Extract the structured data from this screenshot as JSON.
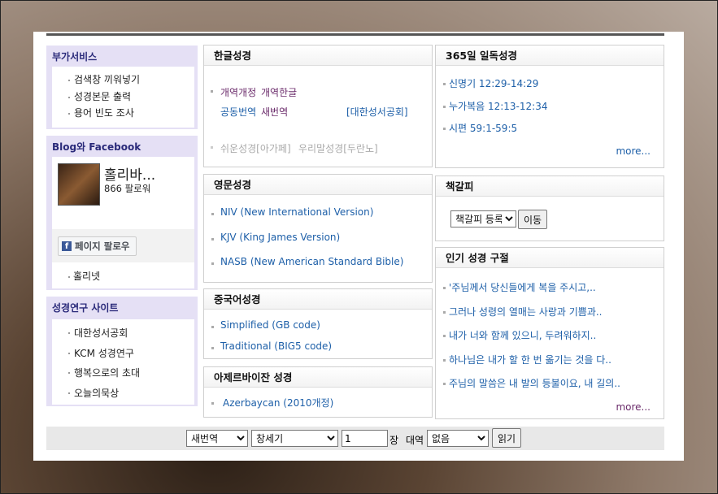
{
  "sidebar": {
    "addon": {
      "title": "부가서비스",
      "items": [
        "검색창 끼워넣기",
        "성경본문 출력",
        "용어 빈도 조사"
      ]
    },
    "social": {
      "title": "Blog와 Facebook",
      "page_name": "홀리바...",
      "followers": "866 팔로워",
      "follow_label": "페이지 팔로우",
      "link": "홀리넷"
    },
    "research": {
      "title": "성경연구 사이트",
      "items": [
        "대한성서공회",
        "KCM 성경연구",
        "행복으로의 초대",
        "오늘의묵상"
      ]
    }
  },
  "korean": {
    "title": "한글성경",
    "r1a": "개역개정",
    "r1b": "개역한글",
    "r2a": "공동번역",
    "r2b": "새번역",
    "r2c": "[대한성서공회]",
    "r3a": "쉬운성경[아가페]",
    "r3b": "우리말성경[두란노]"
  },
  "english": {
    "title": "영문성경",
    "items": [
      "NIV (New International Version)",
      "KJV (King James Version)",
      "NASB (New American Standard Bible)"
    ]
  },
  "chinese": {
    "title": "중국어성경",
    "items": [
      "Simplified (GB code)",
      "Traditional (BIG5 code)"
    ]
  },
  "azeri": {
    "title": "아제르바이잔 성경",
    "items": [
      "Azerbaycan (2010개정)"
    ]
  },
  "daily": {
    "title": "365일 일독성경",
    "items": [
      "신명기 12:29-14:29",
      "누가복음 12:13-12:34",
      "시편 59:1-59:5"
    ],
    "more": "more..."
  },
  "bookmark": {
    "title": "책갈피",
    "select": "책갈피 등록",
    "go": "이동"
  },
  "popular": {
    "title": "인기 성경 구절",
    "items": [
      "'주님께서 당신들에게 복을 주시고,..",
      "그러나 성령의 열매는 사랑과 기쁨과..",
      "내가 너와 함께 있으니, 두려워하지..",
      "하나님은 내가 할 한 번 옮기는 것을 다..",
      "주님의 말씀은 내 발의 등불이요, 내 길의.."
    ],
    "more": "more..."
  },
  "bottom": {
    "version": "새번역",
    "book": "창세기",
    "chapter": "1",
    "chapter_label": "장",
    "compare_label": "대역",
    "compare": "없음",
    "read": "읽기"
  },
  "colors": {
    "side_bg": "#e5e0f5",
    "side_title": "#2a2a7a",
    "link": "#1d5fa8",
    "visited": "#6a2a6a"
  }
}
